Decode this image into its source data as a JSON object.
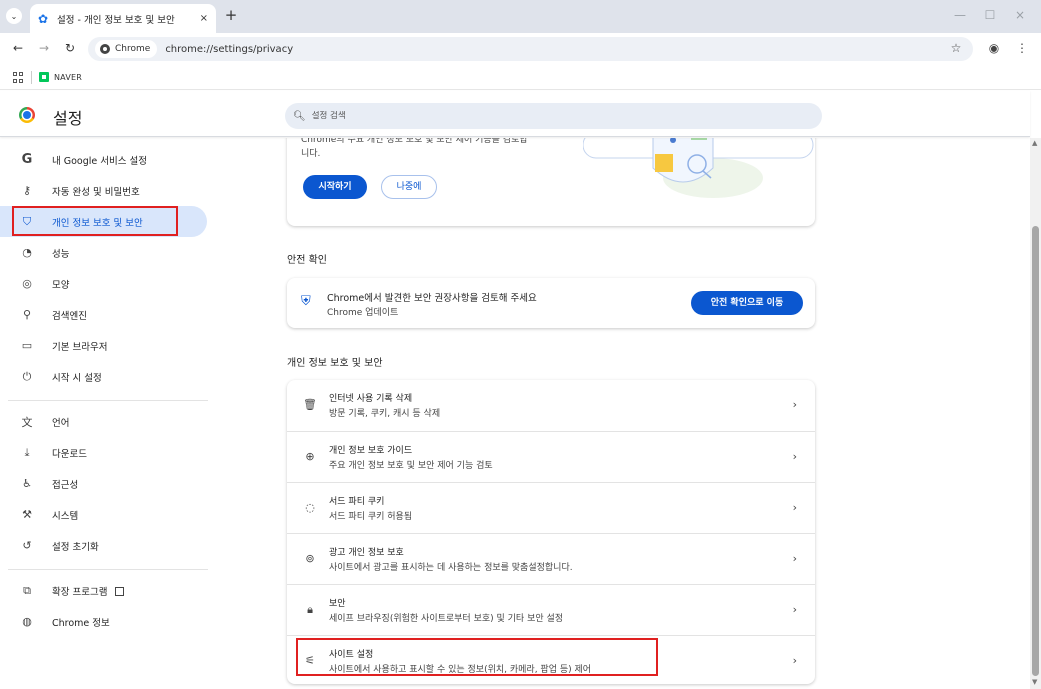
{
  "browser": {
    "tab_title": "설정 - 개인 정보 보호 및 보안",
    "tab_close": "×",
    "new_tab": "+",
    "tab_menu": "⌄",
    "chip_label": "Chrome",
    "url": "chrome://settings/privacy",
    "bookmark_naver": "NAVER",
    "window_minimize": "—",
    "window_restore": "☐",
    "window_close": "×",
    "icons": [
      "back-arrow-icon",
      "forward-arrow-icon",
      "reload-icon",
      "star-icon",
      "profile-icon",
      "more-vert-icon"
    ]
  },
  "header": {
    "title": "설정",
    "search_placeholder": "설정 검색"
  },
  "sidebar": {
    "items": [
      {
        "label": "내 Google 서비스 설정",
        "icon": "google-g-icon"
      },
      {
        "label": "자동 완성 및 비밀번호",
        "icon": "key-icon"
      },
      {
        "label": "개인 정보 보호 및 보안",
        "icon": "shield-icon",
        "active": true
      },
      {
        "label": "성능",
        "icon": "speedometer-icon"
      },
      {
        "label": "모양",
        "icon": "palette-icon"
      },
      {
        "label": "검색엔진",
        "icon": "search-icon"
      },
      {
        "label": "기본 브라우저",
        "icon": "browser-window-icon"
      },
      {
        "label": "시작 시 설정",
        "icon": "power-icon"
      },
      {
        "label": "언어",
        "icon": "translate-icon"
      },
      {
        "label": "다운로드",
        "icon": "download-icon"
      },
      {
        "label": "접근성",
        "icon": "accessibility-icon"
      },
      {
        "label": "시스템",
        "icon": "wrench-icon"
      },
      {
        "label": "설정 초기화",
        "icon": "reset-icon"
      },
      {
        "label": "확장 프로그램",
        "icon": "puzzle-icon"
      },
      {
        "label": "Chrome 정보",
        "icon": "chrome-icon"
      }
    ]
  },
  "promo": {
    "text_line1": "Chrome의 주요 개인 정보 보호 및 보안 제어 기능을 검토합",
    "text_line2": "니다.",
    "start_button": "시작하기",
    "later_button": "나중에"
  },
  "safety": {
    "section_title": "안전 확인",
    "title": "Chrome에서 발견한 보안 권장사항을 검토해 주세요",
    "subtitle": "Chrome 업데이트",
    "button": "안전 확인으로 이동"
  },
  "privacy": {
    "section_title": "개인 정보 보호 및 보안",
    "rows": [
      {
        "title": "인터넷 사용 기록 삭제",
        "subtitle": "방문 기록, 쿠키, 캐시 등 삭제",
        "icon": "trash-icon"
      },
      {
        "title": "개인 정보 보호 가이드",
        "subtitle": "주요 개인 정보 보호 및 보안 제어 기능 검토",
        "icon": "guide-icon"
      },
      {
        "title": "서드 파티 쿠키",
        "subtitle": "서드 파티 쿠키 허용됨",
        "icon": "cookie-icon"
      },
      {
        "title": "광고 개인 정보 보호",
        "subtitle": "사이트에서 광고를 표시하는 데 사용하는 정보를 맞춤설정합니다.",
        "icon": "ad-privacy-icon"
      },
      {
        "title": "보안",
        "subtitle": "세이프 브라우징(위험한 사이트로부터 보호) 및 기타 보안 설정",
        "icon": "lock-icon"
      },
      {
        "title": "사이트 설정",
        "subtitle": "사이트에서 사용하고 표시할 수 있는 정보(위치, 카메라, 팝업 등) 제어",
        "icon": "tune-icon"
      }
    ],
    "arrow": "›"
  },
  "colors": {
    "accent": "#0b57d0",
    "active_bg": "#d9e6fb",
    "highlight_box": "#e02020"
  }
}
